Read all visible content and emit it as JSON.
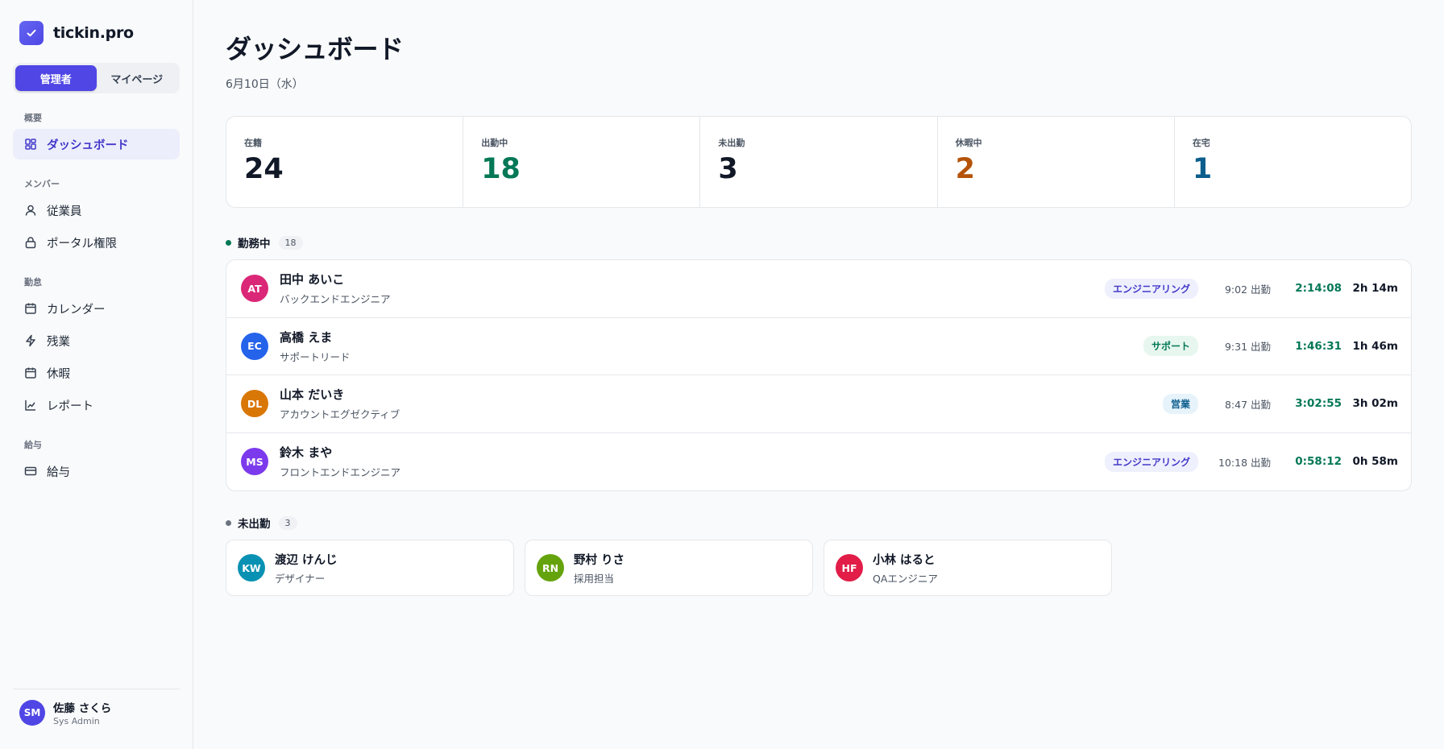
{
  "brand": {
    "name": "tickin.pro",
    "logo_icon": "check-icon",
    "color": "#4f46e5"
  },
  "mode_switch": {
    "admin_label": "管理者",
    "mypage_label": "マイページ",
    "active": "admin"
  },
  "nav": {
    "sections": [
      {
        "heading": "概要",
        "items": [
          {
            "label": "ダッシュボード",
            "icon": "grid-icon",
            "active": true
          }
        ]
      },
      {
        "heading": "メンバー",
        "items": [
          {
            "label": "従業員",
            "icon": "user-icon"
          },
          {
            "label": "ポータル権限",
            "icon": "lock-icon"
          }
        ]
      },
      {
        "heading": "勤怠",
        "items": [
          {
            "label": "カレンダー",
            "icon": "calendar-icon"
          },
          {
            "label": "残業",
            "icon": "bolt-icon"
          },
          {
            "label": "休暇",
            "icon": "calendar-icon"
          },
          {
            "label": "レポート",
            "icon": "chart-icon"
          }
        ]
      },
      {
        "heading": "給与",
        "items": [
          {
            "label": "給与",
            "icon": "card-icon"
          }
        ]
      }
    ]
  },
  "current_user": {
    "initials": "SM",
    "name": "佐藤 さくら",
    "role": "Sys Admin",
    "color": "#4f46e5"
  },
  "page": {
    "title": "ダッシュボード",
    "date": "6月10日（水）"
  },
  "stats": [
    {
      "label": "在籍",
      "value": "24",
      "color": "#111827"
    },
    {
      "label": "出勤中",
      "value": "18",
      "color": "#047857"
    },
    {
      "label": "未出勤",
      "value": "3",
      "color": "#111827"
    },
    {
      "label": "休暇中",
      "value": "2",
      "color": "#b45309"
    },
    {
      "label": "在宅",
      "value": "1",
      "color": "#0c5e8c"
    }
  ],
  "working": {
    "title": "勤務中",
    "count": "18",
    "dot_color": "#047857",
    "rows": [
      {
        "initials": "AT",
        "name": "田中 あいこ",
        "title": "バックエンドエンジニア",
        "color": "#db2777",
        "dept": "エンジニアリング",
        "dept_kind": "eng",
        "clock_in": "9:02 出勤",
        "timer": "2:14:08",
        "duration": "2h 14m"
      },
      {
        "initials": "EC",
        "name": "高橋 えま",
        "title": "サポートリード",
        "color": "#2563eb",
        "dept": "サポート",
        "dept_kind": "sup",
        "clock_in": "9:31 出勤",
        "timer": "1:46:31",
        "duration": "1h 46m"
      },
      {
        "initials": "DL",
        "name": "山本 だいき",
        "title": "アカウントエグゼクティブ",
        "color": "#d97706",
        "dept": "営業",
        "dept_kind": "sales",
        "clock_in": "8:47 出勤",
        "timer": "3:02:55",
        "duration": "3h 02m"
      },
      {
        "initials": "MS",
        "name": "鈴木 まや",
        "title": "フロントエンドエンジニア",
        "color": "#7c3aed",
        "dept": "エンジニアリング",
        "dept_kind": "eng",
        "clock_in": "10:18 出勤",
        "timer": "0:58:12",
        "duration": "0h 58m"
      }
    ]
  },
  "absent": {
    "title": "未出勤",
    "count": "3",
    "dot_color": "#6b7280",
    "cards": [
      {
        "initials": "KW",
        "name": "渡辺 けんじ",
        "title": "デザイナー",
        "color": "#0891b2"
      },
      {
        "initials": "RN",
        "name": "野村 りさ",
        "title": "採用担当",
        "color": "#65a30d"
      },
      {
        "initials": "HF",
        "name": "小林 はると",
        "title": "QAエンジニア",
        "color": "#e11d48"
      }
    ]
  }
}
